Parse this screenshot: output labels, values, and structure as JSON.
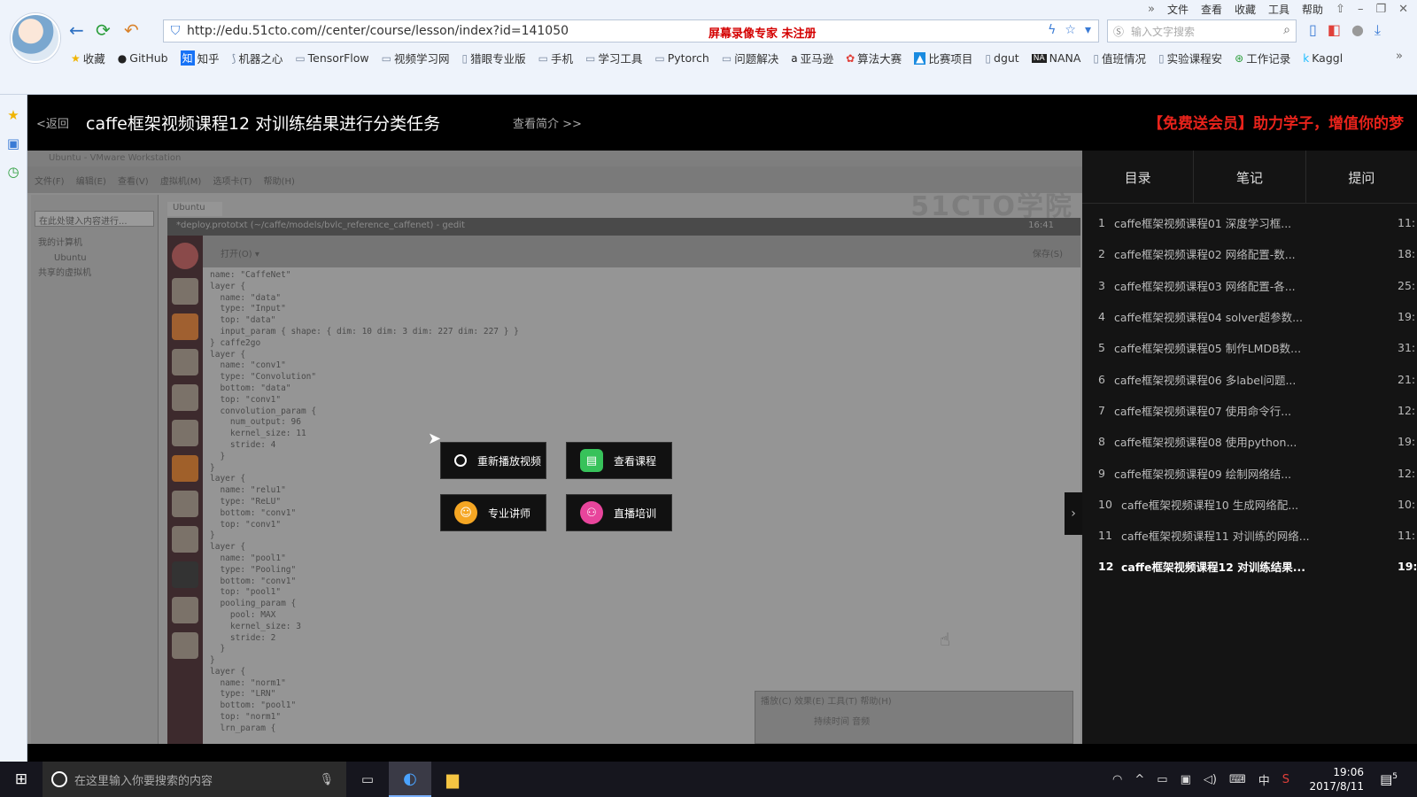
{
  "browser": {
    "menu": [
      "文件",
      "查看",
      "收藏",
      "工具",
      "帮助"
    ],
    "url": "http://edu.51cto.com//center/course/lesson/index?id=141050",
    "recorder_notice": "屏幕录像专家  未注册",
    "search_placeholder": "输入文字搜索",
    "bookmarks": [
      "收藏",
      "GitHub",
      "知乎",
      "机器之心",
      "TensorFlow",
      "视频学习网",
      "猎眼专业版",
      "手机",
      "学习工具",
      "Pytorch",
      "问题解决",
      "亚马逊",
      "算法大赛",
      "比赛项目",
      "dgut",
      "NANA",
      "值班情况",
      "实验课程安",
      "工作记录",
      "Kaggl"
    ]
  },
  "header": {
    "back": "<返回",
    "title": "caffe框架视频课程12 对训练结果进行分类任务",
    "intro": "查看简介 >>",
    "promo": "【免费送会员】助力学子，增值你的梦"
  },
  "video": {
    "vm_title": "Ubuntu - VMware Workstation",
    "vm_menu": "文件(F)  编辑(E)  查看(V)  虚拟机(M)  选项卡(T)  帮助(H)",
    "lib_search": "在此处键入内容进行...",
    "lib_tree": [
      "我的计算机",
      "Ubuntu",
      "共享的虚拟机"
    ],
    "vm_tab": "Ubuntu",
    "gedit_title": "*deploy.prototxt (~/caffe/models/bvlc_reference_caffenet) - gedit",
    "gedit_time": "16:41",
    "gedit_open": "打开(O) ▾",
    "gedit_save": "保存(S)",
    "watermark": "51CTO学院",
    "code": "name: \"CaffeNet\"\nlayer {\n  name: \"data\"\n  type: \"Input\"\n  top: \"data\"\n  input_param { shape: { dim: 10 dim: 3 dim: 227 dim: 227 } }\n} caffe2go\nlayer {\n  name: \"conv1\"\n  type: \"Convolution\"\n  bottom: \"data\"\n  top: \"conv1\"\n  convolution_param {\n    num_output: 96\n    kernel_size: 11\n    stride: 4\n  }\n}\nlayer {\n  name: \"relu1\"\n  type: \"ReLU\"\n  bottom: \"conv1\"\n  top: \"conv1\"\n}\nlayer {\n  name: \"pool1\"\n  type: \"Pooling\"\n  bottom: \"conv1\"\n  top: \"pool1\"\n  pooling_param {\n    pool: MAX\n    kernel_size: 3\n    stride: 2\n  }\n}\nlayer {\n  name: \"norm1\"\n  type: \"LRN\"\n  bottom: \"pool1\"\n  top: \"norm1\"\n  lrn_param {",
    "mini_menu": "播放(C)  效果(E)  工具(T)  帮助(H)",
    "mini_fields": "持续时间          音频",
    "overlay_buttons": [
      "重新播放视频",
      "查看课程",
      "专业讲师",
      "直播培训"
    ]
  },
  "panel": {
    "tabs": [
      "目录",
      "笔记",
      "提问"
    ],
    "lessons": [
      {
        "num": "1",
        "title": "caffe框架视频课程01 深度学习框...",
        "dur": "11:"
      },
      {
        "num": "2",
        "title": "caffe框架视频课程02 网络配置-数...",
        "dur": "18:"
      },
      {
        "num": "3",
        "title": "caffe框架视频课程03 网络配置-各...",
        "dur": "25:"
      },
      {
        "num": "4",
        "title": "caffe框架视频课程04 solver超参数...",
        "dur": "19:"
      },
      {
        "num": "5",
        "title": "caffe框架视频课程05 制作LMDB数...",
        "dur": "31:"
      },
      {
        "num": "6",
        "title": "caffe框架视频课程06 多label问题...",
        "dur": "21:"
      },
      {
        "num": "7",
        "title": "caffe框架视频课程07 使用命令行...",
        "dur": "12:"
      },
      {
        "num": "8",
        "title": "caffe框架视频课程08 使用python...",
        "dur": "19:"
      },
      {
        "num": "9",
        "title": "caffe框架视频课程09 绘制网络结...",
        "dur": "12:"
      },
      {
        "num": "10",
        "title": "caffe框架视频课程10 生成网络配...",
        "dur": "10:"
      },
      {
        "num": "11",
        "title": "caffe框架视频课程11 对训练的网络...",
        "dur": "11:"
      },
      {
        "num": "12",
        "title": "caffe框架视频课程12 对训练结果...",
        "dur": "19:"
      }
    ]
  },
  "taskbar": {
    "search_placeholder": "在这里输入你要搜索的内容",
    "ime": "中",
    "time": "19:06",
    "date": "2017/8/11",
    "notif_count": "5"
  }
}
